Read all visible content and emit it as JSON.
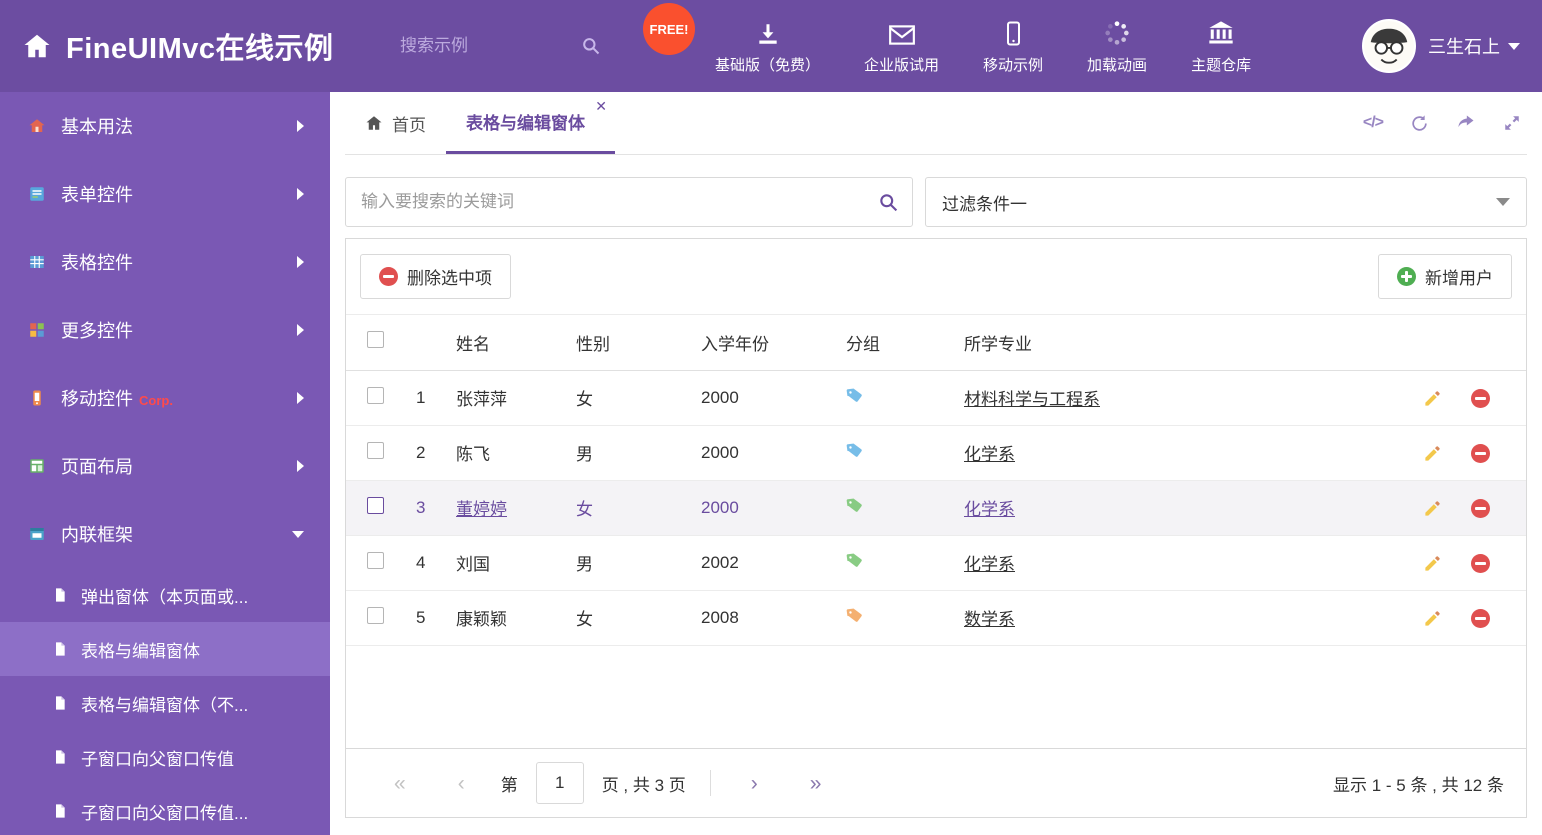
{
  "header": {
    "title": "FineUIMvc在线示例",
    "search_placeholder": "搜索示例",
    "free_badge": "FREE!",
    "nav_items": [
      {
        "label": "基础版（免费）",
        "icon": "download-icon"
      },
      {
        "label": "企业版试用",
        "icon": "envelope-icon"
      },
      {
        "label": "移动示例",
        "icon": "mobile-icon"
      },
      {
        "label": "加载动画",
        "icon": "spinner-icon"
      },
      {
        "label": "主题仓库",
        "icon": "bank-icon"
      }
    ],
    "user_name": "三生石上"
  },
  "sidebar": {
    "items": [
      {
        "label": "基本用法"
      },
      {
        "label": "表单控件"
      },
      {
        "label": "表格控件"
      },
      {
        "label": "更多控件"
      },
      {
        "label": "移动控件",
        "badge": "Corp."
      },
      {
        "label": "页面布局"
      },
      {
        "label": "内联框架"
      }
    ],
    "subitems": [
      {
        "label": "弹出窗体（本页面或..."
      },
      {
        "label": "表格与编辑窗体",
        "active": true
      },
      {
        "label": "表格与编辑窗体（不..."
      },
      {
        "label": "子窗口向父窗口传值"
      },
      {
        "label": "子窗口向父窗口传值..."
      }
    ]
  },
  "tabs": {
    "home_label": "首页",
    "active_label": "表格与编辑窗体"
  },
  "filter": {
    "search_placeholder": "输入要搜索的关键词",
    "dropdown_value": "过滤条件一"
  },
  "toolbar": {
    "delete_label": "删除选中项",
    "add_label": "新增用户"
  },
  "table": {
    "columns": [
      "姓名",
      "性别",
      "入学年份",
      "分组",
      "所学专业"
    ],
    "rows": [
      {
        "num": "1",
        "name": "张萍萍",
        "gender": "女",
        "year": "2000",
        "tag_color": "#5fb2e4",
        "major": "材料科学与工程系",
        "selected": false
      },
      {
        "num": "2",
        "name": "陈飞",
        "gender": "男",
        "year": "2000",
        "tag_color": "#5fb2e4",
        "major": "化学系",
        "selected": false
      },
      {
        "num": "3",
        "name": "董婷婷",
        "gender": "女",
        "year": "2000",
        "tag_color": "#74c36e",
        "major": "化学系",
        "selected": true
      },
      {
        "num": "4",
        "name": "刘国",
        "gender": "男",
        "year": "2002",
        "tag_color": "#74c36e",
        "major": "化学系",
        "selected": false
      },
      {
        "num": "5",
        "name": "康颖颖",
        "gender": "女",
        "year": "2008",
        "tag_color": "#f2a258",
        "major": "数学系",
        "selected": false
      }
    ]
  },
  "pagination": {
    "page_label_prefix": "第",
    "page_value": "1",
    "page_label_suffix": "页 , 共 3 页",
    "summary": "显示 1 - 5 条 , 共 12 条"
  },
  "colors": {
    "header_bg": "#6c4da1",
    "sidebar_bg": "#7a58b4",
    "sidebar_active_bg": "#8d6fc7",
    "accent_purple": "#6a4c9f",
    "free_badge_bg": "#fa502e",
    "delete_red": "#e04f4f",
    "add_green": "#4fae52",
    "tag_blue": "#5fb2e4",
    "tag_green": "#74c36e",
    "tag_orange": "#f2a258",
    "pencil_yellow": "#f3c84b"
  }
}
